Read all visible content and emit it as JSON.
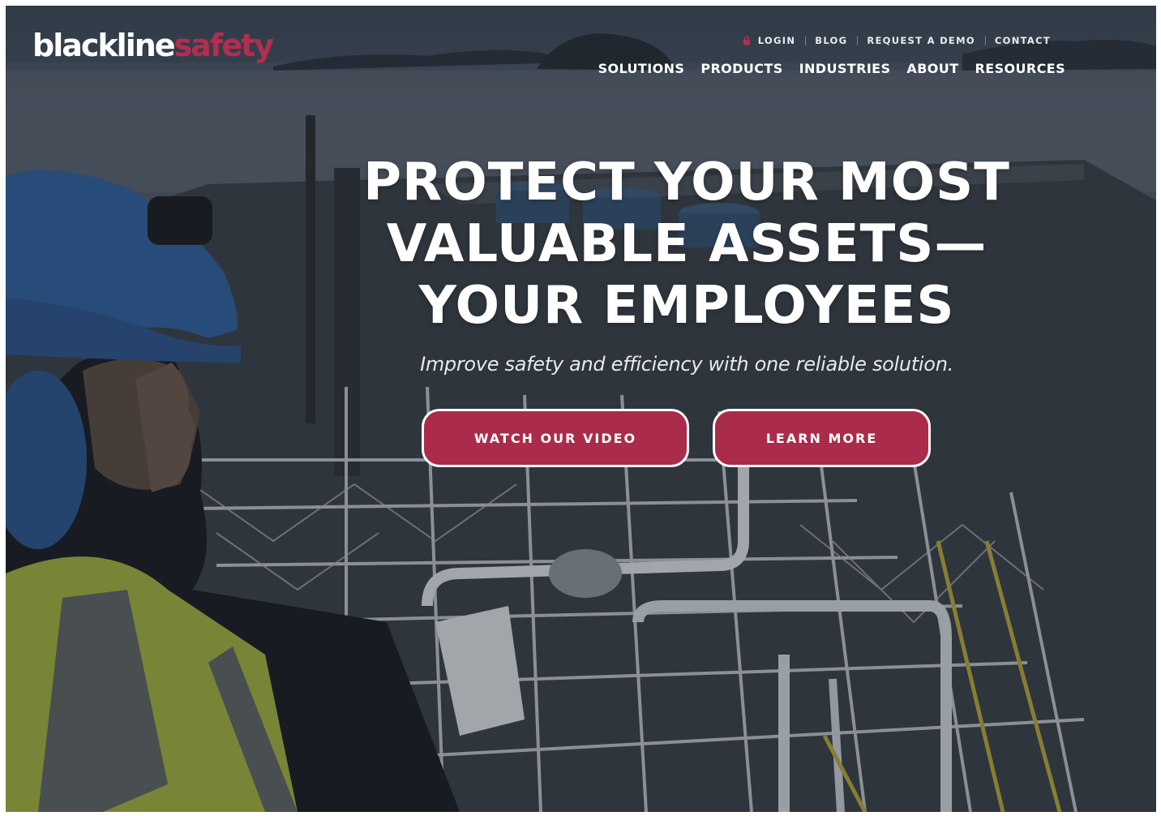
{
  "brand": {
    "logo_part_a": "blackline",
    "logo_part_b": "safety",
    "accent_color": "#aa2b4a"
  },
  "utility_nav": {
    "login_icon": "lock-icon",
    "items": [
      "LOGIN",
      "BLOG",
      "REQUEST A DEMO",
      "CONTACT"
    ]
  },
  "main_nav": {
    "items": [
      "SOLUTIONS",
      "PRODUCTS",
      "INDUSTRIES",
      "ABOUT",
      "RESOURCES"
    ]
  },
  "hero": {
    "title_lines": [
      "PROTECT YOUR MOST",
      "VALUABLE ASSETS—",
      "YOUR EMPLOYEES"
    ],
    "subtitle": "Improve safety and efficiency with one reliable solution.",
    "primary_button": "WATCH OUR VIDEO",
    "secondary_button": "LEARN MORE"
  }
}
